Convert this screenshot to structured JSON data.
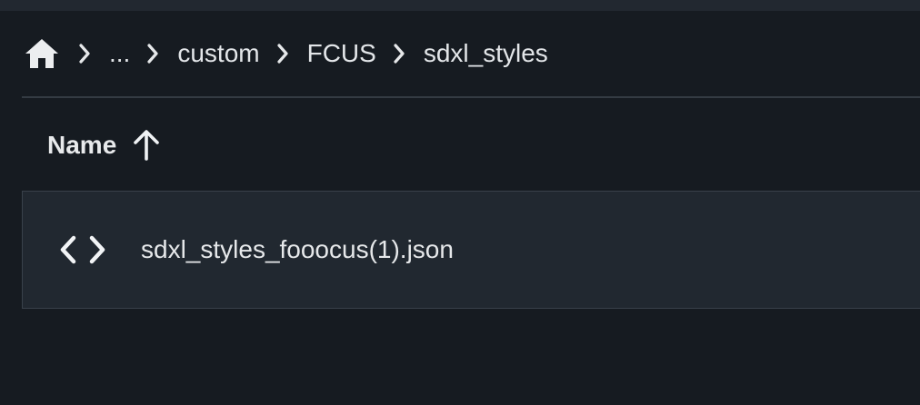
{
  "breadcrumb": {
    "home_icon": "home-icon",
    "separator_icon": "chevron-right-icon",
    "items": [
      "...",
      "custom",
      "FCUS",
      "sdxl_styles"
    ]
  },
  "table": {
    "column_name_label": "Name",
    "sort_icon": "arrow-up-icon",
    "rows": [
      {
        "icon": "code-brackets-icon",
        "name": "sdxl_styles_fooocus(1).json"
      }
    ]
  },
  "colors": {
    "background": "#161b21",
    "row_background": "#212830",
    "text": "#e6e8ea"
  }
}
